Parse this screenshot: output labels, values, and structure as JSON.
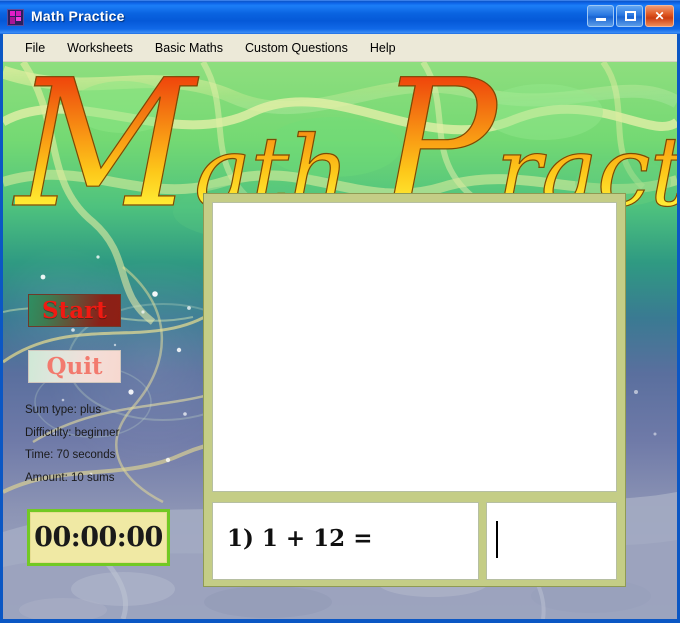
{
  "window": {
    "title": "Math Practice",
    "icon": "app-icon",
    "controls": {
      "minimize": "Minimize",
      "maximize": "Maximize",
      "close": "Close"
    }
  },
  "menubar": {
    "items": [
      {
        "label": "File"
      },
      {
        "label": "Worksheets"
      },
      {
        "label": "Basic Maths"
      },
      {
        "label": "Custom Questions"
      },
      {
        "label": "Help"
      }
    ]
  },
  "logo": {
    "line": "Math Practice",
    "first_letter": "M",
    "rest_first_word": "ath",
    "second_letter": "P",
    "rest_second_word": "ractice"
  },
  "controls": {
    "start_label": "Start",
    "quit_label": "Quit"
  },
  "settings": [
    {
      "label": "Sum type: plus"
    },
    {
      "label": "Difficulty: beginner"
    },
    {
      "label": "Time: 70 seconds"
    },
    {
      "label": "Amount: 10 sums"
    }
  ],
  "settings_values": {
    "sum_type": "plus",
    "difficulty": "beginner",
    "time": "70 seconds",
    "amount": "10 sums"
  },
  "timer": {
    "value": "00:00:00"
  },
  "panels": {
    "answers_log": "",
    "question_text": "1) 1 + 12 =",
    "question_number": "1)",
    "question_expression": "1 + 12 =",
    "answer_value": "",
    "answer_placeholder": ""
  },
  "colors": {
    "titlebar_blue": "#0a63e0",
    "menubar": "#ece9d8",
    "panel_border": "#c4cd86",
    "timer_bg": "#f0e9a4",
    "timer_border": "#72c924",
    "start_text": "#f01a12",
    "quit_text": "#f27a6e",
    "close_button": "#cc3d10"
  }
}
